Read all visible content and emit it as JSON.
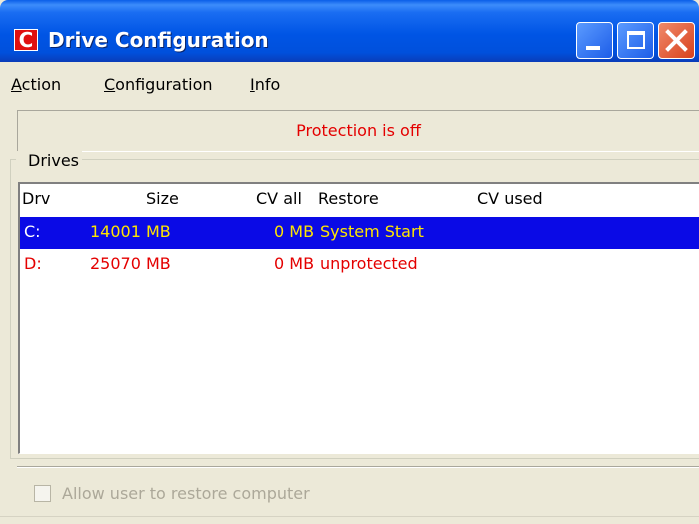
{
  "window": {
    "title": "Drive Configuration",
    "app_icon_letter": "C",
    "controls": [
      "minimize",
      "maximize",
      "close"
    ]
  },
  "menu": {
    "items": [
      {
        "label": "Action",
        "mnemonic": "A"
      },
      {
        "label": "Configuration",
        "mnemonic": "C"
      },
      {
        "label": "Info",
        "mnemonic": "I"
      }
    ]
  },
  "status": {
    "text": "Protection is off",
    "color": "#e40000"
  },
  "drives": {
    "group_label": "Drives",
    "columns": [
      "Drv",
      "Size",
      "CV all",
      "Restore",
      "CV used"
    ],
    "rows": [
      {
        "drv": "C:",
        "size": "14001 MB",
        "cv_all": "0 MB",
        "restore": "System Start",
        "cv_used": "",
        "selected": true
      },
      {
        "drv": "D:",
        "size": "25070 MB",
        "cv_all": "0 MB",
        "restore": "unprotected",
        "cv_used": "",
        "selected": false
      }
    ],
    "selected_row_color": "#0a0ae6",
    "unprotected_color": "#e40000"
  },
  "options": {
    "allow_restore_label": "Allow user to restore computer",
    "allow_restore_checked": false,
    "allow_restore_enabled": false
  }
}
